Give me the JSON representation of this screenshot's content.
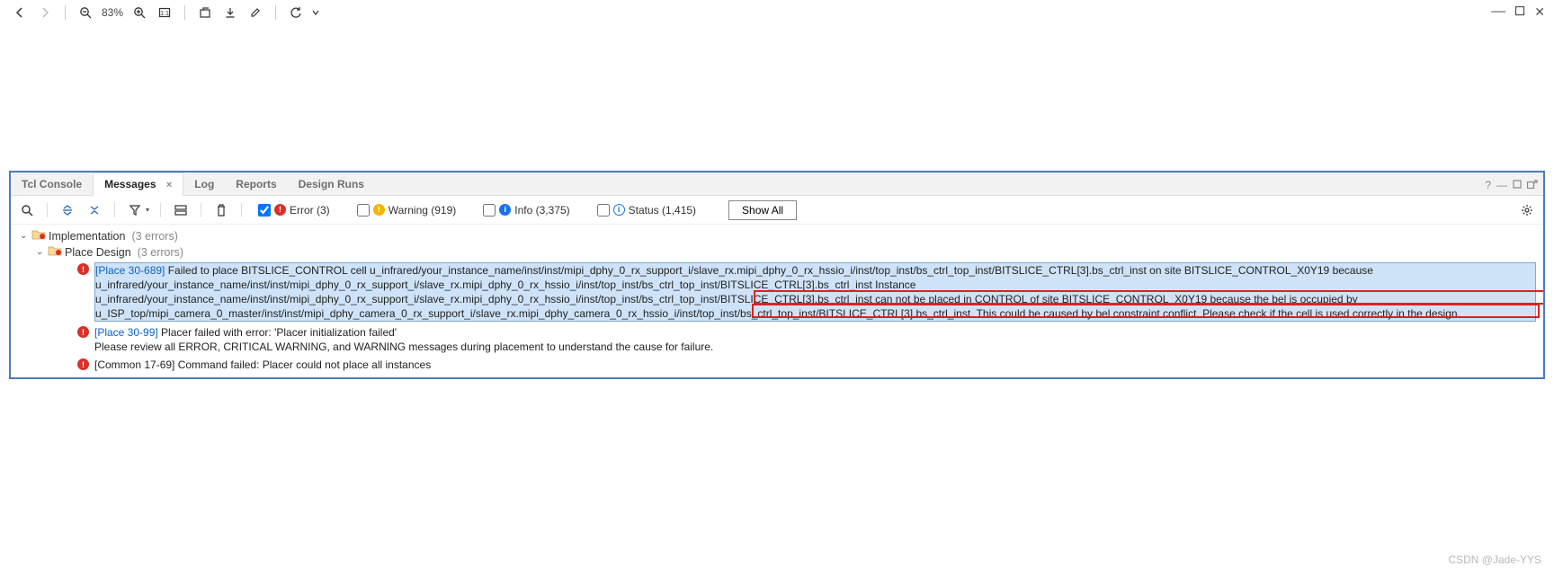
{
  "toolbar": {
    "zoom_text": "83%"
  },
  "tabs": {
    "tcl": "Tcl Console",
    "messages": "Messages",
    "log": "Log",
    "reports": "Reports",
    "design_runs": "Design Runs"
  },
  "filters": {
    "error_label": "Error (3)",
    "warning_label": "Warning (919)",
    "info_label": "Info (3,375)",
    "status_label": "Status (1,415)",
    "show_all": "Show All"
  },
  "tree": {
    "implementation": {
      "label": "Implementation",
      "note": "(3 errors)"
    },
    "place_design": {
      "label": "Place Design",
      "note": "(3 errors)"
    }
  },
  "messages": {
    "m1": {
      "code": "[Place 30-689]",
      "body": " Failed to place BITSLICE_CONTROL cell u_infrared/your_instance_name/inst/inst/mipi_dphy_0_rx_support_i/slave_rx.mipi_dphy_0_rx_hssio_i/inst/top_inst/bs_ctrl_top_inst/BITSLICE_CTRL[3].bs_ctrl_inst on site BITSLICE_CONTROL_X0Y19 because u_infrared/your_instance_name/inst/inst/mipi_dphy_0_rx_support_i/slave_rx.mipi_dphy_0_rx_hssio_i/inst/top_inst/bs_ctrl_top_inst/BITSLICE_CTRL[3].bs_ctrl_inst Instance u_infrared/your_instance_name/inst/inst/mipi_dphy_0_rx_support_i/slave_rx.mipi_dphy_0_rx_hssio_i/inst/top_inst/bs_ctrl_top_inst/BITSLICE_CTRL[3].bs_ctrl_inst can not be placed in CONTROL of site BITSLICE_CONTROL_X0Y19 because the bel is occupied by u_ISP_top/mipi_camera_0_master/inst/inst/mipi_dphy_camera_0_rx_support_i/slave_rx.mipi_dphy_camera_0_rx_hssio_i/inst/top_inst/bs_ctrl_top_inst/BITSLICE_CTRL[3].bs_ctrl_inst. This could be caused by bel constraint conflict. Please check if the cell is used correctly in the design."
    },
    "m2": {
      "code": "[Place 30-99]",
      "body_line1": " Placer failed with error: 'Placer initialization failed'",
      "body_line2": "Please review all ERROR, CRITICAL WARNING, and WARNING messages during placement to understand the cause for failure."
    },
    "m3": {
      "code": "[Common 17-69] ",
      "body": "Command failed: Placer could not place all instances"
    }
  },
  "watermark": "CSDN @Jade-YYS"
}
